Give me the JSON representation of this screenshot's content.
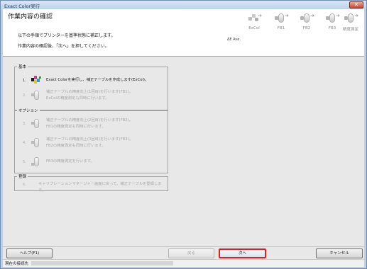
{
  "window": {
    "title": "Exact Color実行",
    "close": "✕"
  },
  "header": {
    "title": "作業内容の確認",
    "line1": "以下の手順でプリンターを基準状態に補正します。",
    "line2": "作業内容の確認後、「次へ」を押してください。",
    "delta_e": "ΔE Ave."
  },
  "steps": [
    {
      "label": "ExCol",
      "icon": "color-chart-icon"
    },
    {
      "label": "FB1",
      "icon": "measure-device-icon"
    },
    {
      "label": "FB2",
      "icon": "measure-device-icon"
    },
    {
      "label": "FB3",
      "icon": "measure-device-icon"
    },
    {
      "label": "精度測定",
      "icon": "measure-device-icon"
    }
  ],
  "groups": {
    "basic": {
      "title": "基本",
      "rows": [
        {
          "num": "1.",
          "line1": "Exact Colorを実行し、補正テーブルを作成します(ExCol)。",
          "line2": "",
          "active": true
        },
        {
          "num": "2.",
          "line1": "補正テーブルの精度向上(1回目)を行います(FB1)。",
          "line2": "ExColの精度測定も同時に行います。",
          "active": false
        }
      ]
    },
    "option": {
      "title": "オプション",
      "rows": [
        {
          "num": "3.",
          "line1": "補正テーブルの精度向上(2回目)を行います(FB2)。",
          "line2": "FB1の精度測定も同時に行います。",
          "active": false
        },
        {
          "num": "4.",
          "line1": "補正テーブルの精度向上(3回目)を行います(FB3)。",
          "line2": "FB2の精度測定も同時に行います。",
          "active": false
        },
        {
          "num": "5.",
          "line1": "FB3の精度測定を行います。",
          "line2": "",
          "active": false
        }
      ]
    },
    "register": {
      "title": "登録",
      "rows": [
        {
          "num": "6.",
          "line1": "キャリブレーションマネージャー画面に戻って、補正テーブルを登録します。",
          "line2": "",
          "active": false
        }
      ]
    }
  },
  "buttons": {
    "help": "ヘルプ(F1)",
    "back": "戻る",
    "next": "次へ",
    "cancel": "キャンセル"
  },
  "status": {
    "label": "現在の接続先"
  }
}
